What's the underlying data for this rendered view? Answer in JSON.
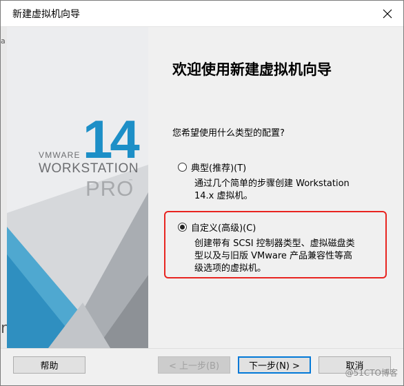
{
  "window": {
    "title": "新建虚拟机向导"
  },
  "titlebar": {
    "close_icon": "close-icon"
  },
  "left_edge": {
    "glyph_top": "a",
    "glyph_bottom": "n"
  },
  "brand": {
    "number": "14",
    "vmware": "VMWARE",
    "workstation": "WORKSTATION",
    "pro": "PRO",
    "trademark": "™",
    "accent": "#1d8fc7"
  },
  "main": {
    "heading": "欢迎使用新建虚拟机向导",
    "question": "您希望使用什么类型的配置?",
    "options": [
      {
        "label": "典型(推荐)(T)",
        "selected": false,
        "desc_lines": [
          "通过几个简单的步骤创建 Workstation",
          "14.x 虚拟机。"
        ]
      },
      {
        "label": "自定义(高级)(C)",
        "selected": true,
        "desc_lines": [
          "创建带有 SCSI 控制器类型、虚拟磁盘类",
          "型以及与旧版 VMware 产品兼容性等高",
          "级选项的虚拟机。"
        ]
      }
    ]
  },
  "annotation": {
    "highlight_color": "#e8231f"
  },
  "footer": {
    "help": "帮助",
    "back": "< 上一步(B)",
    "next": "下一步(N) >",
    "cancel": "取消"
  },
  "watermark": "@51CTO博客"
}
